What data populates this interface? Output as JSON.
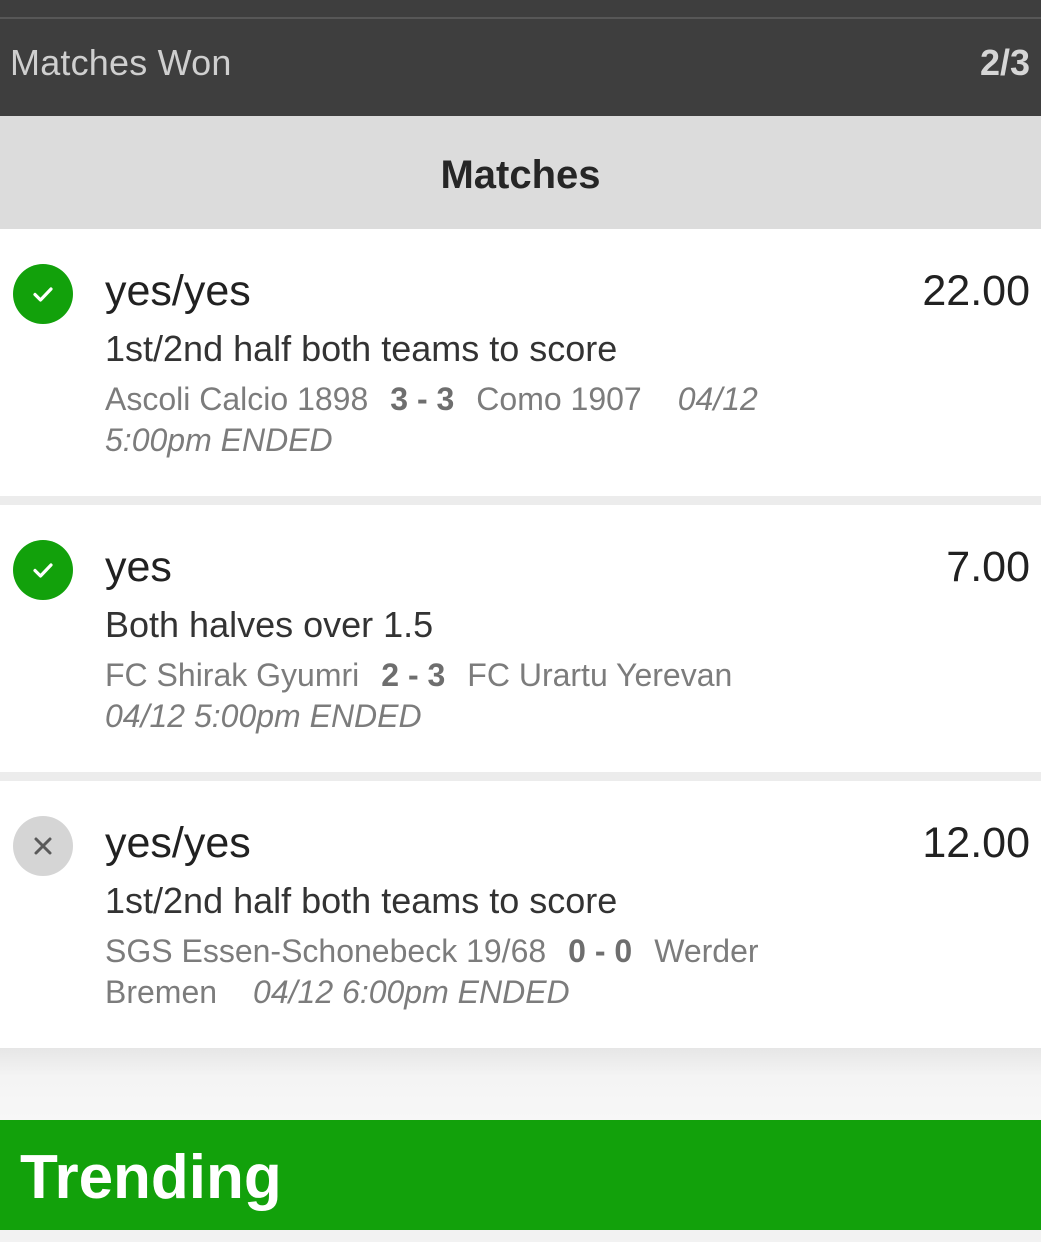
{
  "summary": {
    "label": "Matches Won",
    "value": "2/3"
  },
  "matches_header": "Matches",
  "colors": {
    "won": "#12a10b",
    "lost": "#d5d5d5",
    "trending_bg": "#12a10b",
    "summary_bg": "#3e3e3e"
  },
  "matches": [
    {
      "status": "won",
      "status_icon": "check-icon",
      "pick": "yes/yes",
      "odds": "22.00",
      "market": "1st/2nd half both teams to score",
      "home": "Ascoli Calcio 1898",
      "score": "3 - 3",
      "away": "Como 1907",
      "time": "04/12 5:00pm ENDED"
    },
    {
      "status": "won",
      "status_icon": "check-icon",
      "pick": "yes",
      "odds": "7.00",
      "market": "Both halves over 1.5",
      "home": "FC Shirak Gyumri",
      "score": "2 - 3",
      "away": "FC Urartu Yerevan",
      "time": "04/12 5:00pm ENDED"
    },
    {
      "status": "lost",
      "status_icon": "close-icon",
      "pick": "yes/yes",
      "odds": "12.00",
      "market": "1st/2nd half both teams to score",
      "home": "SGS Essen-Schonebeck 19/68",
      "score": "0 - 0",
      "away": "Werder Bremen",
      "time": "04/12 6:00pm ENDED"
    }
  ],
  "trending_title": "Trending"
}
